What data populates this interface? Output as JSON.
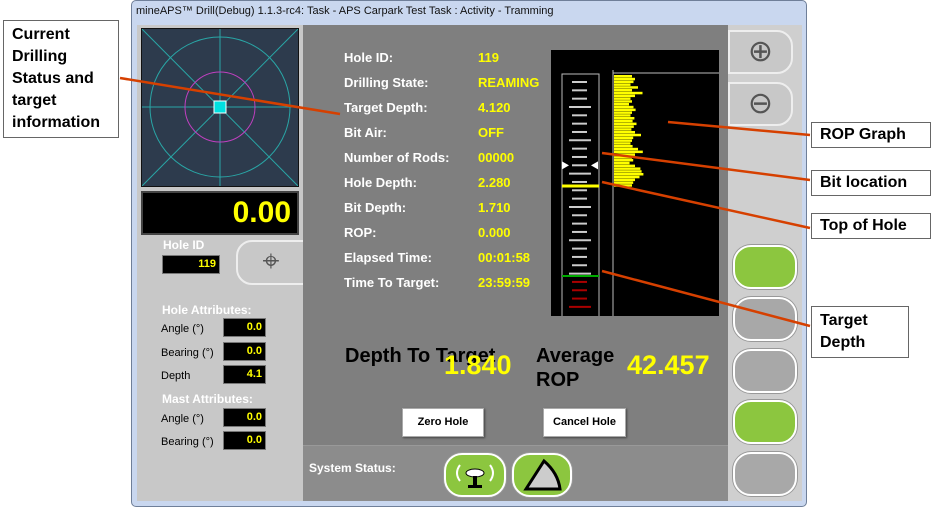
{
  "window": {
    "title": "mineAPS™ Drill(Debug) 1.1.3-rc4: Task - APS Carpark Test Task : Activity - Tramming"
  },
  "left": {
    "depth_display": "0.00",
    "hole_id_label": "Hole ID",
    "hole_id": "119",
    "hole_attributes_label": "Hole Attributes:",
    "hole_attributes": [
      {
        "label": "Angle (°)",
        "value": "0.0"
      },
      {
        "label": "Bearing (°)",
        "value": "0.0"
      },
      {
        "label": "Depth",
        "value": "4.1"
      }
    ],
    "mast_attributes_label": "Mast Attributes:",
    "mast_attributes": [
      {
        "label": "Angle (°)",
        "value": "0.0"
      },
      {
        "label": "Bearing (°)",
        "value": "0.0"
      }
    ]
  },
  "info": [
    {
      "label": "Hole ID:",
      "value": "119"
    },
    {
      "label": "Drilling State:",
      "value": "REAMING"
    },
    {
      "label": "Target Depth:",
      "value": "4.120"
    },
    {
      "label": "Bit Air:",
      "value": "OFF"
    },
    {
      "label": "Number of Rods:",
      "value": "00000"
    },
    {
      "label": "Hole Depth:",
      "value": "2.280"
    },
    {
      "label": "Bit Depth:",
      "value": "1.710"
    },
    {
      "label": "ROP:",
      "value": "0.000"
    },
    {
      "label": "Elapsed Time:",
      "value": "00:01:58"
    },
    {
      "label": "Time To Target:",
      "value": "23:59:59"
    }
  ],
  "summary": {
    "depth_to_target_label": "Depth To Target",
    "depth_to_target": "1.840",
    "avg_rop_label": "Average ROP",
    "avg_rop": "42.457"
  },
  "buttons": {
    "zero_hole": "Zero Hole",
    "cancel_hole": "Cancel Hole"
  },
  "status": {
    "label": "System Status:"
  },
  "gauge": {
    "bit_depth": 1.71,
    "hole_depth": 2.28,
    "target_depth": 4.12,
    "colors": {
      "hole": "#ffff00",
      "target": "#00aa00",
      "below": "#aa0000",
      "rop": "#ffff00"
    }
  },
  "rop_graph": [
    60,
    70,
    65,
    55,
    80,
    60,
    95,
    70,
    55,
    60,
    50,
    65,
    72,
    60,
    55,
    68,
    62,
    75,
    66,
    58,
    70,
    90,
    64,
    60,
    55,
    62,
    80,
    96,
    70,
    60,
    64,
    52,
    70,
    88,
    92,
    98,
    85,
    70,
    64,
    60
  ],
  "annotations": {
    "left": "Current Drilling Status and target information",
    "rop_graph": "ROP Graph",
    "bit_location": "Bit location",
    "top_of_hole": "Top of Hole",
    "target_depth": "Target Depth"
  },
  "colors": {
    "annotation_arrow": "#d64000",
    "accent_green": "#8cc63f",
    "value_yellow": "#ffff00"
  }
}
